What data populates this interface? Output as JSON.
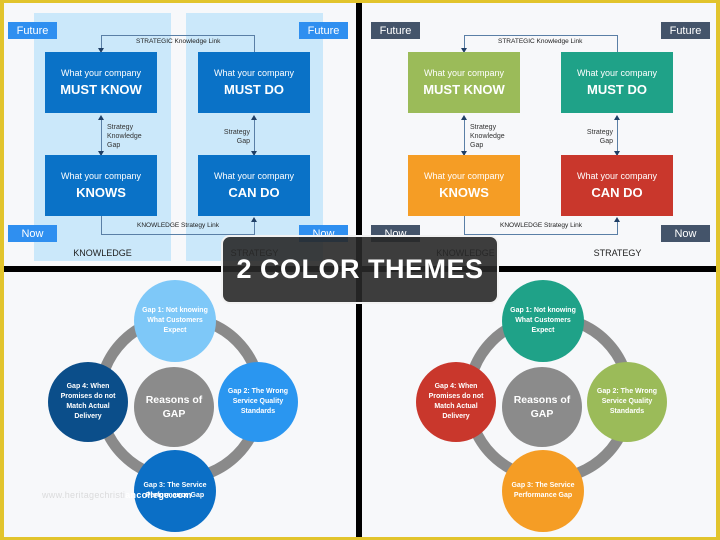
{
  "themes": [
    {
      "name": "blue-theme",
      "colors": {
        "tag": "#2f8ff0",
        "col_bg": "#cbe8fa",
        "must_know": "#0a72c7",
        "must_do": "#0a72c7",
        "knows": "#0a72c7",
        "can_do": "#0a72c7",
        "gap1": "#7ec8f8",
        "gap2": "#2a96f0",
        "gap3": "#0b6fc6",
        "gap4": "#0b4e8a"
      }
    },
    {
      "name": "multi-color-theme",
      "colors": {
        "tag": "#44546a",
        "col_bg": "transparent",
        "must_know": "#9bbb59",
        "must_do": "#1fa288",
        "knows": "#f59d25",
        "can_do": "#c9372c",
        "gap1": "#1fa288",
        "gap2": "#9bbb59",
        "gap3": "#f59d25",
        "gap4": "#c9372c"
      }
    }
  ],
  "strategy_diagram": {
    "future_label": "Future",
    "now_label": "Now",
    "strategic_link": "STRATEGIC Knowledge Link",
    "knowledge_link": "KNOWLEDGE Strategy Link",
    "knowledge_column": "KNOWLEDGE",
    "strategy_column": "STRATEGY",
    "boxes": {
      "must_know": {
        "sub": "What your company",
        "main": "MUST KNOW"
      },
      "must_do": {
        "sub": "What your company",
        "main": "MUST DO"
      },
      "knows": {
        "sub": "What your company",
        "main": "KNOWS"
      },
      "can_do": {
        "sub": "What your company",
        "main": "CAN DO"
      }
    },
    "knowledge_gap_label": "Strategy Knowledge Gap",
    "strategy_gap_label": "Strategy Gap"
  },
  "gap_diagram": {
    "center": "Reasons of GAP",
    "gap1": "Gap 1: Not knowing What Customers Expect",
    "gap2": "Gap 2: The Wrong Service Quality Standards",
    "gap3": "Gap 3: The Service Performance Gap",
    "gap4": "Gap 4: When Promises do not Match Actual Delivery"
  },
  "watermark": {
    "faint": "www.heritagechristi",
    "strong": "ancollege.com"
  },
  "banner": {
    "text": "2 COLOR THEMES"
  }
}
